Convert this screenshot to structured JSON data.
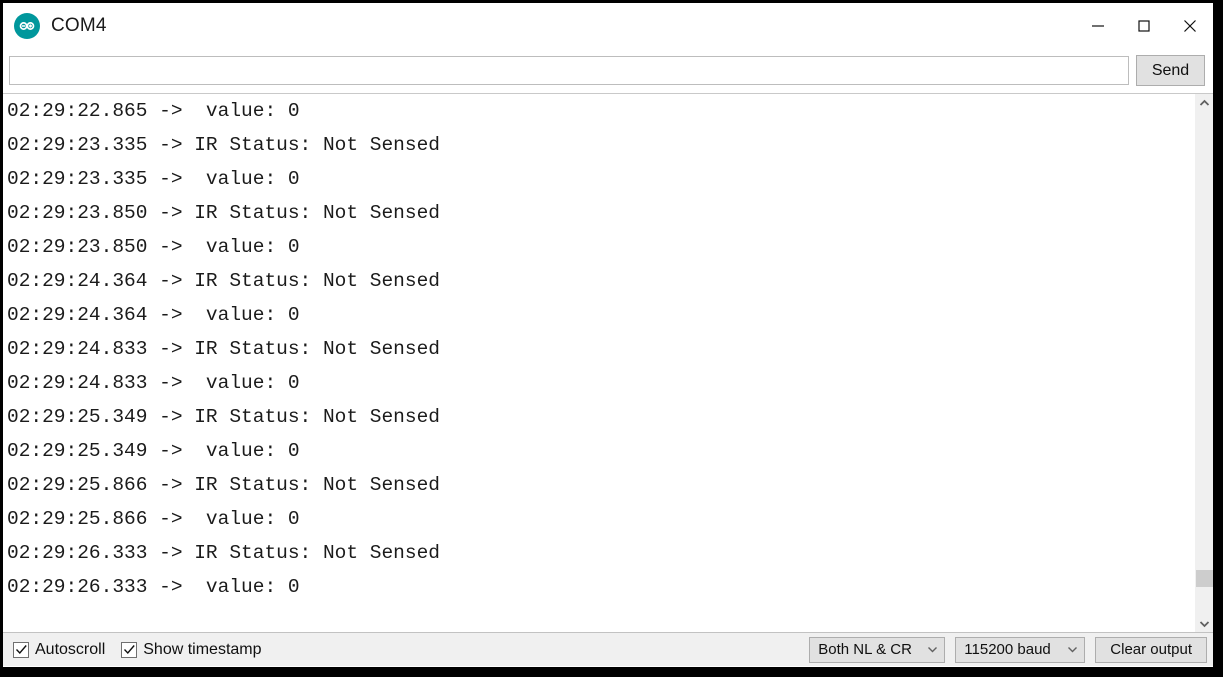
{
  "window": {
    "title": "COM4",
    "app_icon": "arduino-infinity-icon",
    "controls": {
      "minimize": "minimize-icon",
      "maximize": "maximize-icon",
      "close": "close-icon"
    }
  },
  "send_bar": {
    "input_value": "",
    "input_placeholder": "",
    "send_label": "Send"
  },
  "console": {
    "lines": [
      "02:29:22.865 ->  value: 0",
      "02:29:23.335 -> IR Status: Not Sensed",
      "02:29:23.335 ->  value: 0",
      "02:29:23.850 -> IR Status: Not Sensed",
      "02:29:23.850 ->  value: 0",
      "02:29:24.364 -> IR Status: Not Sensed",
      "02:29:24.364 ->  value: 0",
      "02:29:24.833 -> IR Status: Not Sensed",
      "02:29:24.833 ->  value: 0",
      "02:29:25.349 -> IR Status: Not Sensed",
      "02:29:25.349 ->  value: 0",
      "02:29:25.866 -> IR Status: Not Sensed",
      "02:29:25.866 ->  value: 0",
      "02:29:26.333 -> IR Status: Not Sensed",
      "02:29:26.333 ->  value: 0"
    ]
  },
  "scrollbar": {
    "up_arrow_icon": "chevron-up-icon",
    "down_arrow_icon": "chevron-down-icon",
    "thumb_top_pct": 91,
    "thumb_height_pct": 3.5
  },
  "status_bar": {
    "autoscroll": {
      "label": "Autoscroll",
      "checked": true
    },
    "show_timestamp": {
      "label": "Show timestamp",
      "checked": true
    },
    "line_ending": {
      "value": "Both NL & CR",
      "caret_icon": "chevron-down-icon"
    },
    "baud_rate": {
      "value": "115200 baud",
      "caret_icon": "chevron-down-icon"
    },
    "clear_output_label": "Clear output"
  },
  "colors": {
    "accent": "#00979c",
    "window_bg": "#ffffff",
    "status_bg": "#f0f0f0",
    "text": "#1b1b1b",
    "frame": "#000000"
  }
}
